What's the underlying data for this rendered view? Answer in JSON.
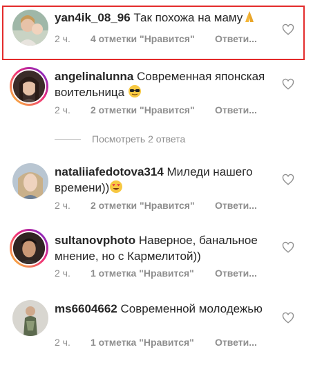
{
  "comments": [
    {
      "username": "yan4ik_08_96",
      "text": "Так похожа на маму",
      "emoji": "folded-hands-emoji",
      "time": "2 ч.",
      "likes": "4 отметки \"Нравится\"",
      "reply": "Ответи..."
    },
    {
      "username": "angelinalunna",
      "text": "Современная японская воительница",
      "emoji": "sunglasses-emoji",
      "time": "2 ч.",
      "likes": "2 отметки \"Нравится\"",
      "reply": "Ответи..."
    },
    {
      "username": "nataliiafedotova314",
      "text": "Миледи нашего времени))",
      "emoji": "heart-eyes-emoji",
      "time": "2 ч.",
      "likes": "2 отметки \"Нравится\"",
      "reply": "Ответи..."
    },
    {
      "username": "sultanovphoto",
      "text": "Наверное, банальное мнение, но с Кармелитой))",
      "emoji": "",
      "time": "2 ч.",
      "likes": "1 отметка \"Нравится\"",
      "reply": "Ответи..."
    },
    {
      "username": "ms6604662",
      "text": "Современной молодежью",
      "emoji": "",
      "time": "2 ч.",
      "likes": "1 отметка \"Нравится\"",
      "reply": "Ответи..."
    }
  ],
  "view_replies": "Посмотреть 2 ответа",
  "colors": {
    "highlight": "#e32b2b",
    "secondary_text": "#8e8e8e",
    "primary_text": "#262626"
  }
}
